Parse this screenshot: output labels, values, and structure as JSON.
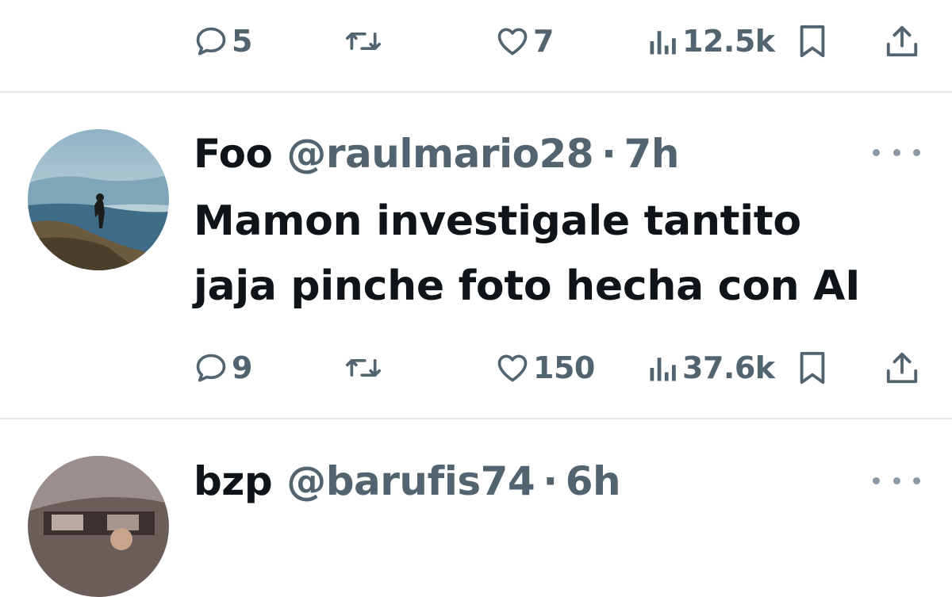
{
  "tweets": [
    {
      "stats": {
        "replies": "5",
        "retweets": "",
        "likes": "7",
        "views": "12.5k"
      }
    },
    {
      "author": {
        "name": "Foo",
        "handle": "@raulmario28",
        "separator": "·",
        "time": "7h"
      },
      "text_line1": "Mamon investigale tantito",
      "text_line2": "jaja pinche foto hecha con AI",
      "stats": {
        "replies": "9",
        "retweets": "",
        "likes": "150",
        "views": "37.6k"
      }
    },
    {
      "author": {
        "name": "bzp",
        "handle": "@barufis74",
        "separator": "·",
        "time": "6h"
      }
    }
  ],
  "icons": {
    "reply": "comment-bubble-icon",
    "retweet": "retweet-icon",
    "like": "heart-icon",
    "views": "bar-chart-icon",
    "bookmark": "bookmark-icon",
    "share": "share-upload-icon",
    "more": "more-dots-icon"
  },
  "colors": {
    "text": "#0f1419",
    "secondary": "#536471",
    "divider": "#e7e9ea"
  }
}
